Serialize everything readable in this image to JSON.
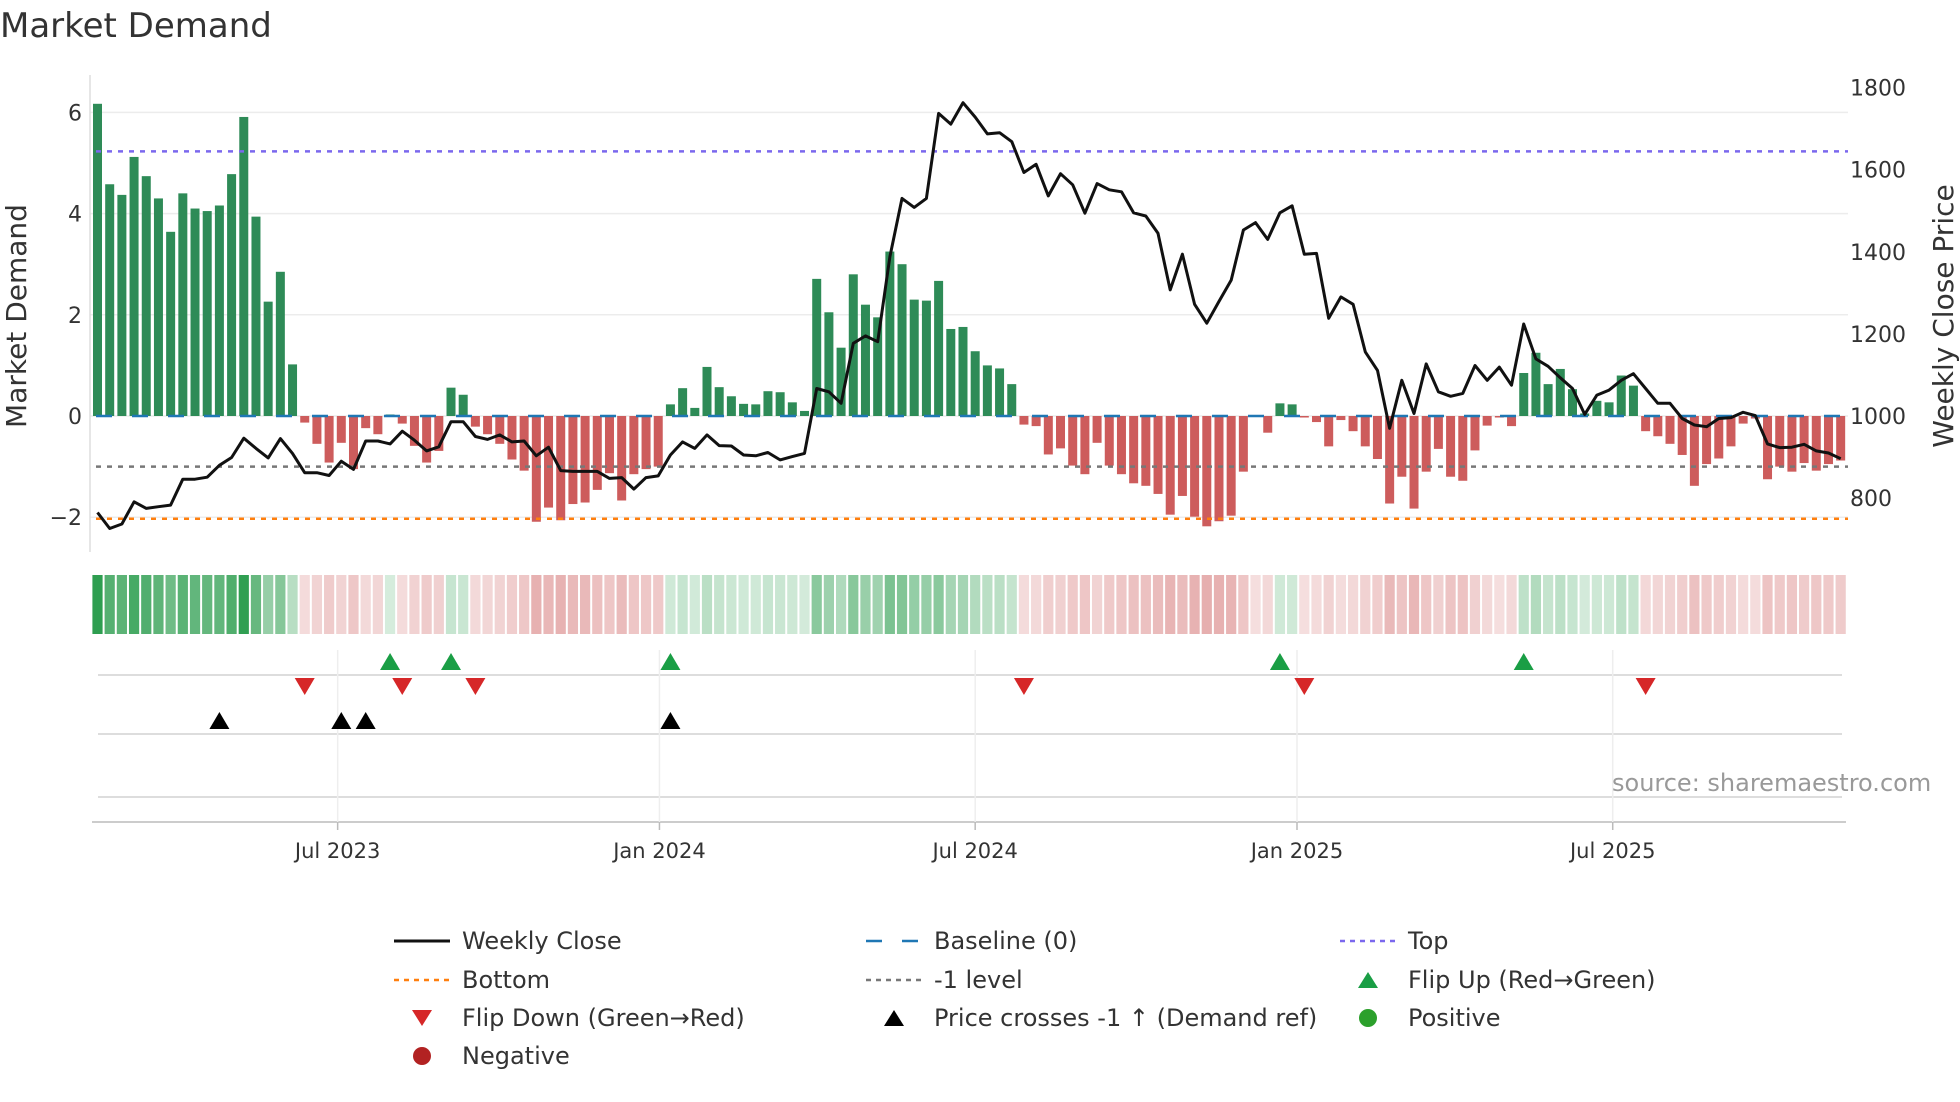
{
  "title": "Market Demand",
  "source": "source: sharemaestro.com",
  "colors": {
    "positive_bar": "#2e8b57",
    "negative_bar": "#cd5c5c",
    "strip_positive": "#2e9e50",
    "strip_negative": "#cd5c5c",
    "price_line": "#111111",
    "baseline": "#1f77b4",
    "top": "#7b68ee",
    "bottom": "#ff7f0e",
    "minus_one": "#777777",
    "flip_up": "#1a9e45",
    "flip_down": "#d62728",
    "cross": "#000000",
    "positive_dot": "#2ca02c",
    "negative_dot": "#b22222"
  },
  "legend": [
    {
      "label": "Weekly Close",
      "icon": "solid-line-icon"
    },
    {
      "label": "Baseline (0)",
      "icon": "dashed-line-icon"
    },
    {
      "label": "Top",
      "icon": "dotted-line-icon"
    },
    {
      "label": "Bottom",
      "icon": "dotted-line-icon"
    },
    {
      "label": "-1 level",
      "icon": "dotted-line-icon"
    },
    {
      "label": "Flip Up (Red→Green)",
      "icon": "triangle-up-icon"
    },
    {
      "label": "Flip Down (Green→Red)",
      "icon": "triangle-down-icon"
    },
    {
      "label": "Price crosses -1 ↑ (Demand ref)",
      "icon": "triangle-up-icon"
    },
    {
      "label": "Positive",
      "icon": "circle-icon"
    },
    {
      "label": "Negative",
      "icon": "circle-icon"
    }
  ],
  "chart_data": {
    "type": "bar",
    "title": "Market Demand",
    "ylabel": "Market Demand",
    "y2label": "Weekly Close Price",
    "ylim": [
      -2.6,
      6.5
    ],
    "y2lim": [
      700,
      1810
    ],
    "yticks": [
      {
        "v": 6,
        "label": "6"
      },
      {
        "v": 4,
        "label": "4"
      },
      {
        "v": 2,
        "label": "2"
      },
      {
        "v": 0,
        "label": "0"
      },
      {
        "v": -2,
        "label": "−2"
      }
    ],
    "y2ticks": [
      {
        "v": 1800,
        "label": "1800"
      },
      {
        "v": 1600,
        "label": "1600"
      },
      {
        "v": 1400,
        "label": "1400"
      },
      {
        "v": 1200,
        "label": "1200"
      },
      {
        "v": 1000,
        "label": "1000"
      },
      {
        "v": 800,
        "label": "800"
      }
    ],
    "xticks": [
      {
        "week": 19.7,
        "label": "Jul 2023"
      },
      {
        "week": 46.1,
        "label": "Jan 2024"
      },
      {
        "week": 72.0,
        "label": "Jul 2024"
      },
      {
        "week": 98.4,
        "label": "Jan 2025"
      },
      {
        "week": 124.3,
        "label": "Jul 2025"
      }
    ],
    "levels": {
      "top": 5.23,
      "bottom": -2.03,
      "minus_one": -1,
      "baseline": 0
    },
    "demand": [
      6.17,
      4.58,
      4.37,
      5.12,
      4.74,
      4.3,
      3.64,
      4.4,
      4.1,
      4.05,
      4.16,
      4.78,
      5.91,
      3.94,
      2.26,
      2.85,
      1.02,
      -0.13,
      -0.55,
      -0.92,
      -0.53,
      -1.05,
      -0.24,
      -0.36,
      0.03,
      -0.15,
      -0.59,
      -0.92,
      -0.69,
      0.56,
      0.42,
      -0.21,
      -0.36,
      -0.55,
      -0.86,
      -1.08,
      -2.09,
      -1.81,
      -2.06,
      -1.74,
      -1.71,
      -1.46,
      -1.13,
      -1.67,
      -1.15,
      -1.05,
      -1.0,
      0.23,
      0.55,
      0.16,
      0.97,
      0.57,
      0.39,
      0.24,
      0.23,
      0.49,
      0.47,
      0.27,
      0.1,
      2.71,
      2.05,
      1.35,
      2.8,
      2.2,
      1.95,
      3.25,
      3.0,
      2.3,
      2.28,
      2.67,
      1.72,
      1.76,
      1.28,
      1.0,
      0.94,
      0.63,
      -0.17,
      -0.2,
      -0.76,
      -0.64,
      -0.98,
      -1.15,
      -0.53,
      -0.98,
      -1.15,
      -1.33,
      -1.38,
      -1.54,
      -1.95,
      -1.58,
      -1.99,
      -2.18,
      -2.08,
      -1.97,
      -1.1,
      -0.02,
      -0.33,
      0.25,
      0.23,
      -0.03,
      -0.12,
      -0.6,
      -0.08,
      -0.3,
      -0.6,
      -0.85,
      -1.73,
      -1.2,
      -1.83,
      -1.1,
      -0.65,
      -1.2,
      -1.28,
      -0.68,
      -0.19,
      -0.03,
      -0.2,
      0.85,
      1.25,
      0.63,
      0.93,
      0.53,
      0.05,
      0.3,
      0.27,
      0.8,
      0.6,
      -0.3,
      -0.4,
      -0.55,
      -0.77,
      -1.38,
      -0.95,
      -0.84,
      -0.6,
      -0.15,
      -0.05,
      -1.25,
      -1.0,
      -1.1,
      -0.93,
      -1.08,
      -0.95,
      -0.88
    ],
    "weekly_close": [
      765,
      726,
      737,
      791,
      775,
      779,
      783,
      846,
      846,
      851,
      880,
      899,
      946,
      921,
      898,
      945,
      909,
      862,
      862,
      855,
      890,
      870,
      939,
      939,
      932,
      963,
      941,
      915,
      925,
      986,
      986,
      950,
      943,
      954,
      937,
      939,
      903,
      924,
      867,
      865,
      865,
      865,
      848,
      850,
      822,
      850,
      854,
      905,
      937,
      921,
      954,
      928,
      927,
      905,
      903,
      911,
      893,
      901,
      909,
      1067,
      1059,
      1031,
      1177,
      1195,
      1181,
      1388,
      1530,
      1508,
      1530,
      1737,
      1711,
      1763,
      1728,
      1687,
      1690,
      1668,
      1593,
      1613,
      1536,
      1590,
      1563,
      1494,
      1566,
      1551,
      1546,
      1495,
      1487,
      1445,
      1307,
      1394,
      1272,
      1226,
      1279,
      1331,
      1453,
      1471,
      1430,
      1495,
      1512,
      1394,
      1396,
      1238,
      1290,
      1272,
      1156,
      1111,
      970,
      1087,
      1006,
      1127,
      1059,
      1048,
      1055,
      1123,
      1087,
      1119,
      1075,
      1224,
      1139,
      1121,
      1093,
      1067,
      1004,
      1051,
      1063,
      1087,
      1103,
      1067,
      1031,
      1031,
      994,
      978,
      974,
      994,
      996,
      1009,
      1001,
      932,
      923,
      924,
      931,
      915,
      910,
      896
    ],
    "flip_up_weeks": [
      24,
      29,
      47,
      97,
      117
    ],
    "flip_down_weeks": [
      17,
      25,
      31,
      76,
      99,
      127
    ],
    "price_cross_weeks": [
      10,
      20,
      22,
      47
    ]
  }
}
